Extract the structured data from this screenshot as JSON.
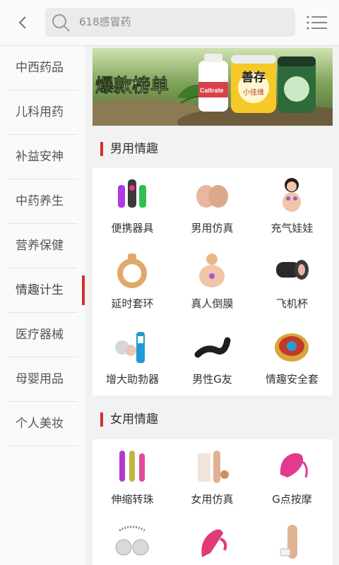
{
  "header": {
    "search_placeholder": "618感冒药"
  },
  "sidebar": {
    "items": [
      {
        "label": "中西药品"
      },
      {
        "label": "儿科用药"
      },
      {
        "label": "补益安神"
      },
      {
        "label": "中药养生"
      },
      {
        "label": "营养保健"
      },
      {
        "label": "情趣计生"
      },
      {
        "label": "医疗器械"
      },
      {
        "label": "母婴用品"
      },
      {
        "label": "个人美妆"
      }
    ],
    "active_index": 5
  },
  "banner": {
    "headline": "爆款榜单",
    "product_labels": [
      "Caltrate",
      "善存",
      "小佳维"
    ]
  },
  "sections": [
    {
      "title": "男用情趣",
      "items": [
        {
          "label": "便携器具"
        },
        {
          "label": "男用仿真"
        },
        {
          "label": "充气娃娃"
        },
        {
          "label": "延时套环"
        },
        {
          "label": "真人倒膜"
        },
        {
          "label": "飞机杯"
        },
        {
          "label": "增大助勃器"
        },
        {
          "label": "男性G友"
        },
        {
          "label": "情趣安全套"
        }
      ]
    },
    {
      "title": "女用情趣",
      "items": [
        {
          "label": "伸缩转珠"
        },
        {
          "label": "女用仿真"
        },
        {
          "label": "G点按摩"
        },
        {
          "label": ""
        },
        {
          "label": ""
        },
        {
          "label": ""
        }
      ]
    }
  ],
  "colors": {
    "accent": "#d32f2f",
    "background": "#f2f2f2"
  }
}
